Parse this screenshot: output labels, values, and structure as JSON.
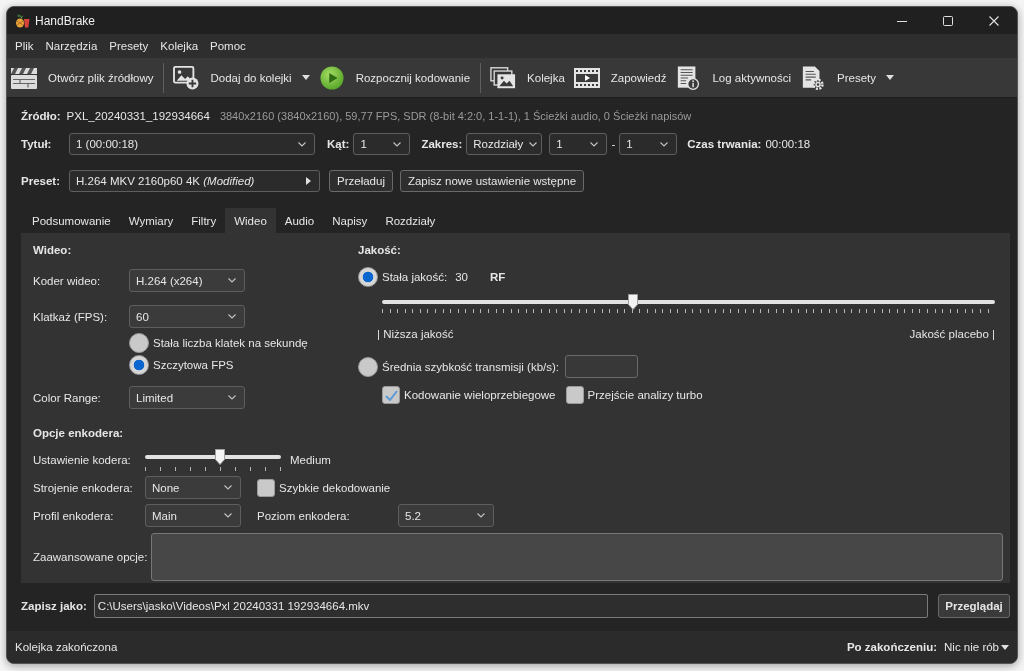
{
  "window": {
    "title": "HandBrake"
  },
  "menu": [
    "Plik",
    "Narzędzia",
    "Presety",
    "Kolejka",
    "Pomoc"
  ],
  "toolbar": [
    [
      {
        "kind": "open",
        "label": "Otwórz plik źródłowy",
        "dropdown": false
      }
    ],
    [
      {
        "kind": "add_queue",
        "label": "Dodaj do kolejki",
        "dropdown": true
      },
      {
        "kind": "start",
        "label": "Rozpocznij kodowanie",
        "dropdown": false
      }
    ],
    [
      {
        "kind": "queue",
        "label": "Kolejka",
        "dropdown": false
      },
      {
        "kind": "preview",
        "label": "Zapowiedź",
        "dropdown": false
      },
      {
        "kind": "log",
        "label": "Log aktywności",
        "dropdown": false
      },
      {
        "kind": "presets",
        "label": "Presety",
        "dropdown": true
      }
    ]
  ],
  "source": {
    "label": "Źródło:",
    "name": "PXL_20240331_192934664",
    "details": "3840x2160 (3840x2160), 59,77 FPS, SDR (8-bit 4:2:0, 1-1-1), 1 Ścieżki audio, 0 Ścieżki napisów"
  },
  "title_row": {
    "title": {
      "label": "Tytuł:",
      "value": "1 (00:00:18)"
    },
    "angle": {
      "label": "Kąt:",
      "value": "1"
    },
    "range": {
      "label": "Zakres:",
      "mode": "Rozdziały",
      "start": "1",
      "separator": "-",
      "end": "1"
    },
    "duration": {
      "label": "Czas trwania:",
      "value": "00:00:18"
    }
  },
  "preset": {
    "label": "Preset:",
    "value": "H.264 MKV 2160p60 4K *(Modified)*",
    "buttons": [
      "Przeładuj",
      "Zapisz nowe ustawienie wstępne"
    ]
  },
  "tabs": [
    {
      "label": "Podsumowanie",
      "selected": false
    },
    {
      "label": "Wymiary",
      "selected": false
    },
    {
      "label": "Filtry",
      "selected": false
    },
    {
      "label": "Wideo",
      "selected": true
    },
    {
      "label": "Audio",
      "selected": false
    },
    {
      "label": "Napisy",
      "selected": false
    },
    {
      "label": "Rozdziały",
      "selected": false
    }
  ],
  "video": {
    "heading": "Wideo:",
    "encoder": {
      "label": "Koder wideo:",
      "value": "H.264 (x264)"
    },
    "framerate": {
      "label": "Klatkaż (FPS):",
      "value": "60"
    },
    "framerate_modes": [
      {
        "label": "Stała liczba klatek na sekundę",
        "selected": false
      },
      {
        "label": "Szczytowa FPS",
        "selected": true
      }
    ],
    "color_range": {
      "label": "Color Range:",
      "value": "Limited"
    }
  },
  "quality": {
    "heading": "Jakość:",
    "constant": {
      "selected": true,
      "label": "Stała jakość:",
      "value": "30",
      "unit": "RF",
      "level": 0.41,
      "low_label": "| Niższa jakość",
      "high_label": "Jakość placebo |"
    },
    "average_bitrate": {
      "selected": false,
      "label": "Średnia szybkość transmisji (kb/s):"
    },
    "options": [
      {
        "label": "Kodowanie wieloprzebiegowe",
        "checked": true
      },
      {
        "label": "Przejście analizy turbo",
        "checked": false
      }
    ]
  },
  "encoder_options": {
    "heading": "Opcje enkodera:",
    "preset": {
      "label": "Ustawienie kodera:",
      "level": 0.55,
      "value": "Medium"
    },
    "tune": {
      "label": "Strojenie enkodera:",
      "value": "None"
    },
    "fast_decode": {
      "label": "Szybkie dekodowanie",
      "checked": false
    },
    "profile": {
      "label": "Profil enkodera:",
      "value": "Main"
    },
    "encoder_level": {
      "label": "Poziom enkodera:",
      "value": "5.2"
    },
    "advanced": {
      "label": "Zaawansowane opcje:"
    }
  },
  "save_as": {
    "label": "Zapisz jako:",
    "value": "C:\\Users\\jasko\\Videos\\Pxl 20240331 192934664.mkv",
    "button": "Przeglądaj"
  },
  "status_bar": {
    "text": "Kolejka zakończona",
    "after_label": "Po zakończeniu:",
    "after_value": "Nic nie rób"
  }
}
